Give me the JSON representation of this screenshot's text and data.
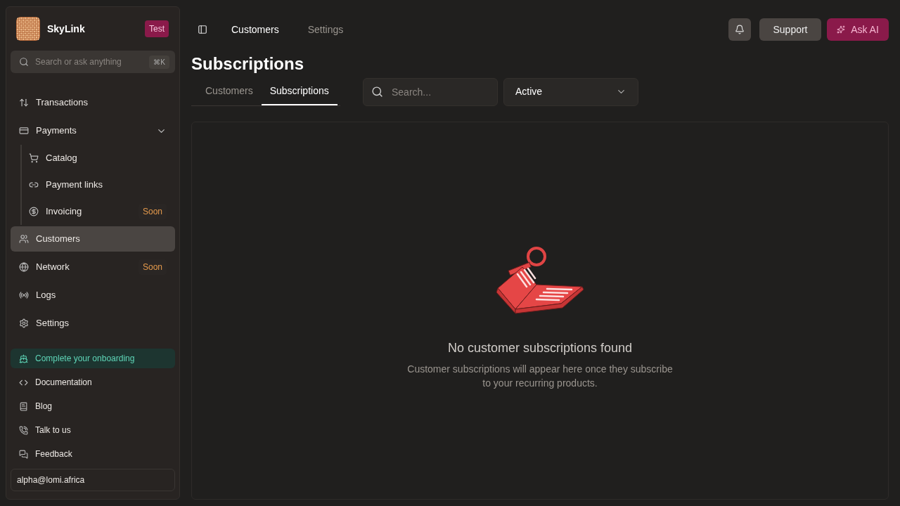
{
  "org": {
    "name": "SkyLink",
    "badge": "Test"
  },
  "sidebar_search": {
    "placeholder": "Search or ask anything",
    "shortcut": "⌘K"
  },
  "nav": [
    {
      "label": "Transactions",
      "selected": false
    },
    {
      "label": "Payments",
      "selected": false,
      "expanded": true,
      "children": [
        {
          "label": "Catalog",
          "selected": false
        },
        {
          "label": "Payment links",
          "selected": false
        },
        {
          "label": "Invoicing",
          "selected": false,
          "badge": "Soon"
        }
      ]
    },
    {
      "label": "Customers",
      "selected": true
    },
    {
      "label": "Network",
      "selected": false,
      "badge": "Soon"
    },
    {
      "label": "Logs",
      "selected": false
    },
    {
      "label": "Settings",
      "selected": false
    }
  ],
  "onboarding": "Complete your onboarding",
  "links": [
    "Documentation",
    "Blog",
    "Talk to us",
    "Feedback"
  ],
  "account": "alpha@lomi.africa",
  "breadcrumbs": [
    {
      "label": "Customers",
      "selected": true
    },
    {
      "label": "Settings",
      "selected": false
    }
  ],
  "actions": {
    "support": "Support",
    "ask_ai": "Ask AI"
  },
  "page_title": "Subscriptions",
  "tabs": [
    {
      "label": "Customers",
      "selected": false
    },
    {
      "label": "Subscriptions",
      "selected": true
    }
  ],
  "search": {
    "placeholder": "Search..."
  },
  "status_filter": {
    "value": "Active"
  },
  "empty": {
    "title": "No customer subscriptions found",
    "text": "Customer subscriptions will appear here once they subscribe to your recurring products."
  }
}
